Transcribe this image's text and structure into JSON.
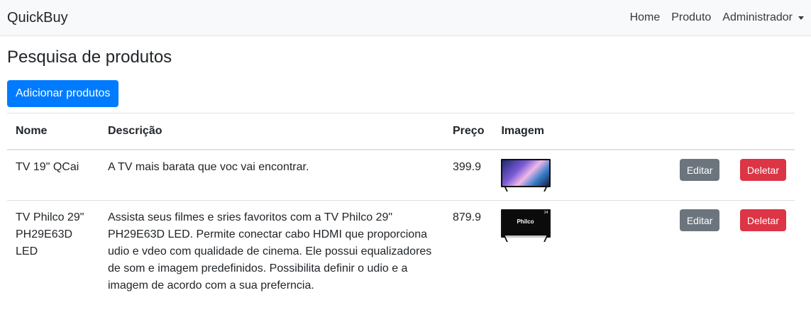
{
  "navbar": {
    "brand": "QuickBuy",
    "links": [
      "Home",
      "Produto",
      "Administrador"
    ]
  },
  "page": {
    "title": "Pesquisa de produtos",
    "add_button": "Adicionar produtos"
  },
  "table": {
    "headers": [
      "Nome",
      "Descrição",
      "Preço",
      "Imagem"
    ],
    "rows": [
      {
        "nome": "TV 19\" QCai",
        "descricao": "A TV mais barata que voc vai encontrar.",
        "preco": "399.9",
        "image_icon": "tv-thumbnail-icon",
        "edit_label": "Editar",
        "delete_label": "Deletar"
      },
      {
        "nome": "TV Philco 29\" PH29E63D LED",
        "descricao": "Assista seus filmes e sries favoritos com a TV Philco 29\" PH29E63D LED. Permite conectar cabo HDMI que proporciona udio e vdeo com qualidade de cinema. Ele possui equalizadores de som e imagem predefinidos. Possibilita definir o udio e a imagem de acordo com a sua preferncia.",
        "preco": "879.9",
        "image_icon": "tv-thumbnail-icon",
        "image_logo": "Philco",
        "image_badge": "24",
        "edit_label": "Editar",
        "delete_label": "Deletar"
      }
    ]
  },
  "colors": {
    "primary": "#007bff",
    "secondary": "#6c757d",
    "danger": "#dc3545",
    "navbar_bg": "#f8f9fa"
  }
}
